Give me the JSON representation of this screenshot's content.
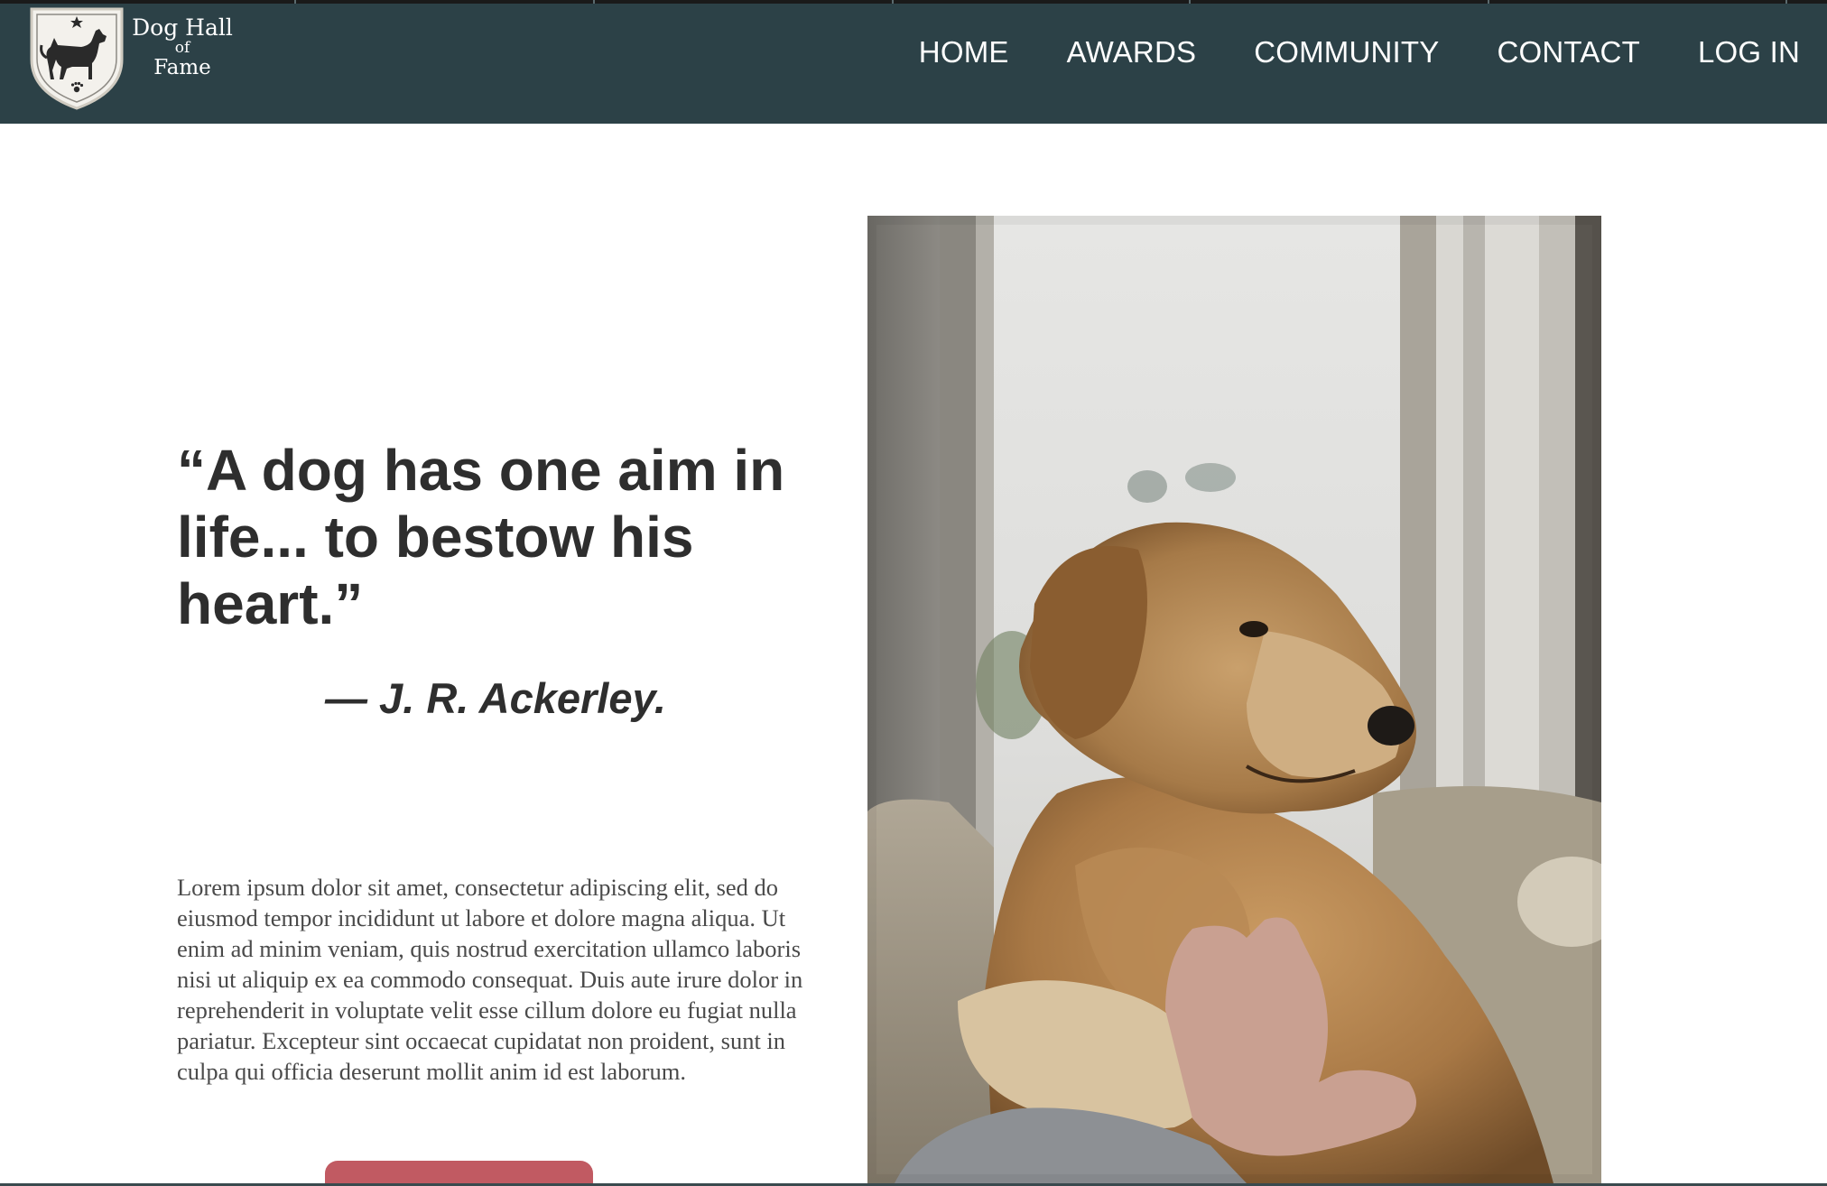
{
  "logo": {
    "line1": "Dog Hall",
    "line2": "of",
    "line3": "Fame"
  },
  "nav": {
    "items": [
      {
        "label": "HOME"
      },
      {
        "label": "AWARDS"
      },
      {
        "label": "COMMUNITY"
      },
      {
        "label": "CONTACT"
      },
      {
        "label": "LOG IN"
      }
    ]
  },
  "hero": {
    "quote": "“A dog has one aim in life... to bestow his heart.”",
    "attribution": "— J. R. Ackerley.",
    "body": "Lorem ipsum dolor sit amet, consectetur adipiscing elit, sed do eiusmod tempor incididunt ut labore et dolore magna aliqua. Ut enim ad minim veniam, quis nostrud exercitation ullamco laboris nisi ut aliquip ex ea commodo consequat. Duis aute irure dolor in reprehenderit in voluptate velit esse cillum dolore eu fugiat nulla pariatur. Excepteur sint occaecat cupidatat non proident, sunt in culpa qui officia deserunt mollit anim id est laborum."
  },
  "colors": {
    "header_bg": "#2c4147",
    "text_dark": "#2e2e2e",
    "body_text": "#4a4a4a",
    "button": "#c15a62"
  },
  "icons": {
    "logo_emblem": "dog-shield-icon"
  }
}
